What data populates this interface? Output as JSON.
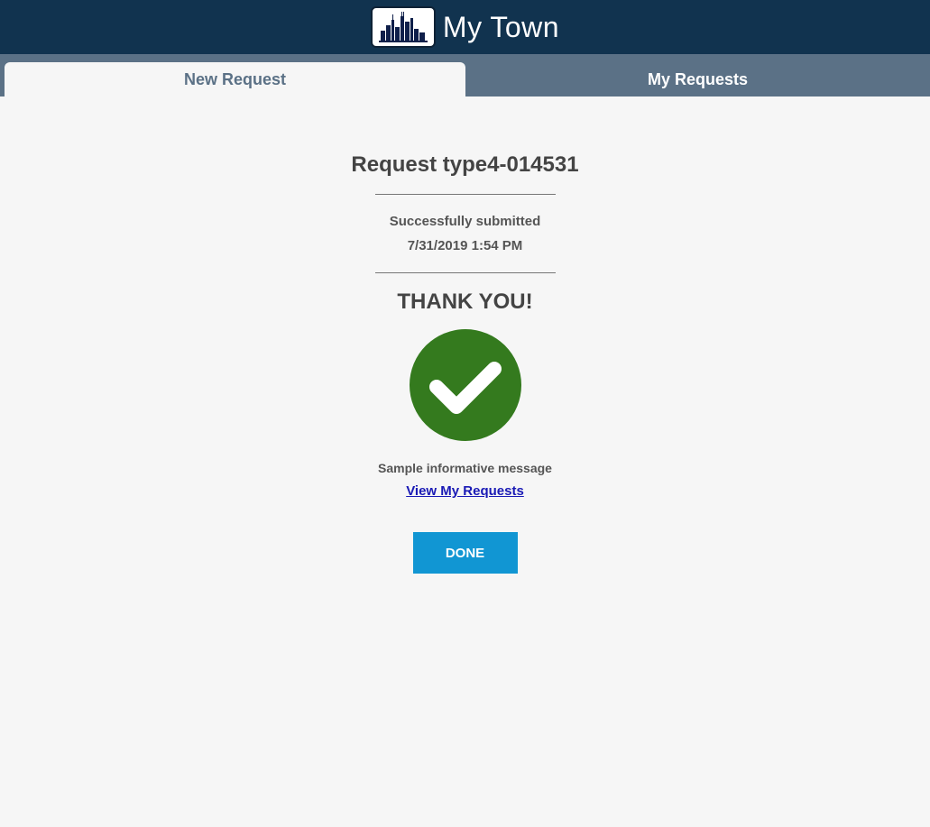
{
  "header": {
    "title": "My Town",
    "logo_icon": "city-skyline-icon"
  },
  "tabs": [
    {
      "label": "New Request",
      "active": true
    },
    {
      "label": "My Requests",
      "active": false
    }
  ],
  "confirmation": {
    "title": "Request type4-014531",
    "status": "Successfully submitted",
    "timestamp": "7/31/2019 1:54 PM",
    "thanks": "THANK YOU!",
    "icon": "check-circle-icon",
    "message": "Sample informative message",
    "link_label": "View My Requests",
    "done_label": "DONE"
  },
  "colors": {
    "header_bg": "#11334f",
    "tabbar_bg": "#5b7186",
    "success_green": "#347a1e",
    "button_blue": "#1196d3",
    "link_blue": "#1a1ab5"
  }
}
